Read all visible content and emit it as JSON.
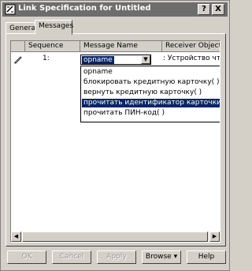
{
  "window": {
    "title": "Link Specification for Untitled",
    "help_button": "?",
    "close_button": "X"
  },
  "tabs": [
    {
      "label": "General",
      "active": false
    },
    {
      "label": "Messages",
      "active": true
    }
  ],
  "grid": {
    "columns": [
      "Sequence",
      "Message Name",
      "Receiver Object"
    ],
    "rows": [
      {
        "sequence": "1:",
        "message_name": "opname",
        "receiver": ": Устройство чте"
      }
    ]
  },
  "dropdown": {
    "items": [
      {
        "label": "opname",
        "selected": false
      },
      {
        "label": "блокировать кредитную карточку( )",
        "selected": false
      },
      {
        "label": "вернуть кредитную карточку( )",
        "selected": false
      },
      {
        "label": "прочитать идентификатор карточки( )",
        "selected": true
      },
      {
        "label": "прочитать ПИН-код( )",
        "selected": false
      }
    ]
  },
  "buttons": {
    "ok": "OK",
    "cancel": "Cancel",
    "apply": "Apply",
    "browse": "Browse",
    "browse_arrow": "▾",
    "help": "Help"
  },
  "colors": {
    "titlebar": "#6d6d6d",
    "selection": "#0a246a",
    "face": "#d4d0c8"
  }
}
